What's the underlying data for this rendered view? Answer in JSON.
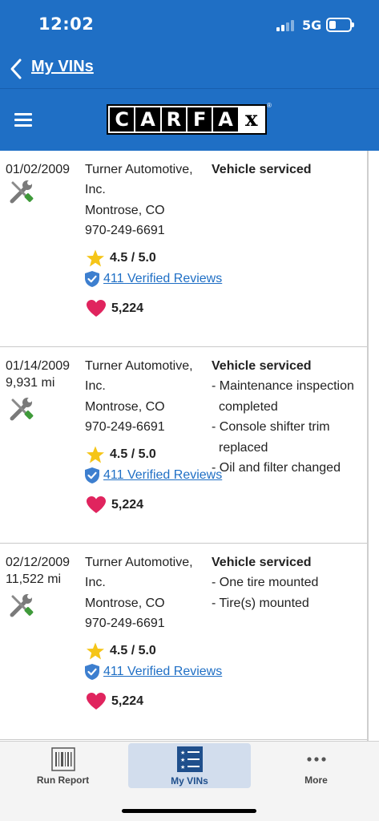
{
  "status_bar": {
    "time": "12:02",
    "network": "5G"
  },
  "nav": {
    "back_label": "My VINs"
  },
  "header": {
    "logo_letters": [
      "C",
      "A",
      "R",
      "F",
      "A",
      "x"
    ],
    "logo_registered": "®"
  },
  "records": [
    {
      "date": "01/02/2009",
      "odometer": "",
      "source_lines": [
        "Turner Automotive,",
        "Inc.",
        "Montrose, CO",
        "970-249-6691"
      ],
      "rating": "4.5 / 5.0",
      "reviews": "411 Verified Reviews",
      "favorites": "5,224",
      "comment_title": "Vehicle serviced",
      "details": []
    },
    {
      "date": "01/14/2009",
      "odometer": "9,931 mi",
      "source_lines": [
        "Turner Automotive,",
        "Inc.",
        "Montrose, CO",
        "970-249-6691"
      ],
      "rating": "4.5 / 5.0",
      "reviews": "411 Verified Reviews",
      "favorites": "5,224",
      "comment_title": "Vehicle serviced",
      "details": [
        "- Maintenance inspection completed",
        "- Console shifter trim replaced",
        "- Oil and filter changed"
      ]
    },
    {
      "date": "02/12/2009",
      "odometer": "11,522 mi",
      "source_lines": [
        "Turner Automotive,",
        "Inc.",
        "Montrose, CO",
        "970-249-6691"
      ],
      "rating": "4.5 / 5.0",
      "reviews": "411 Verified Reviews",
      "favorites": "5,224",
      "comment_title": "Vehicle serviced",
      "details": [
        "- One tire mounted",
        "- Tire(s) mounted"
      ]
    }
  ],
  "tabs": [
    {
      "label": "Run Report",
      "icon": "barcode-icon",
      "active": false
    },
    {
      "label": "My VINs",
      "icon": "list-icon",
      "active": true
    },
    {
      "label": "More",
      "icon": "more-dots-icon",
      "active": false
    }
  ],
  "colors": {
    "brand_blue": "#1f6fc5",
    "star": "#f5c518",
    "heart": "#e0245e",
    "wrench_green": "#3f9a3a"
  }
}
